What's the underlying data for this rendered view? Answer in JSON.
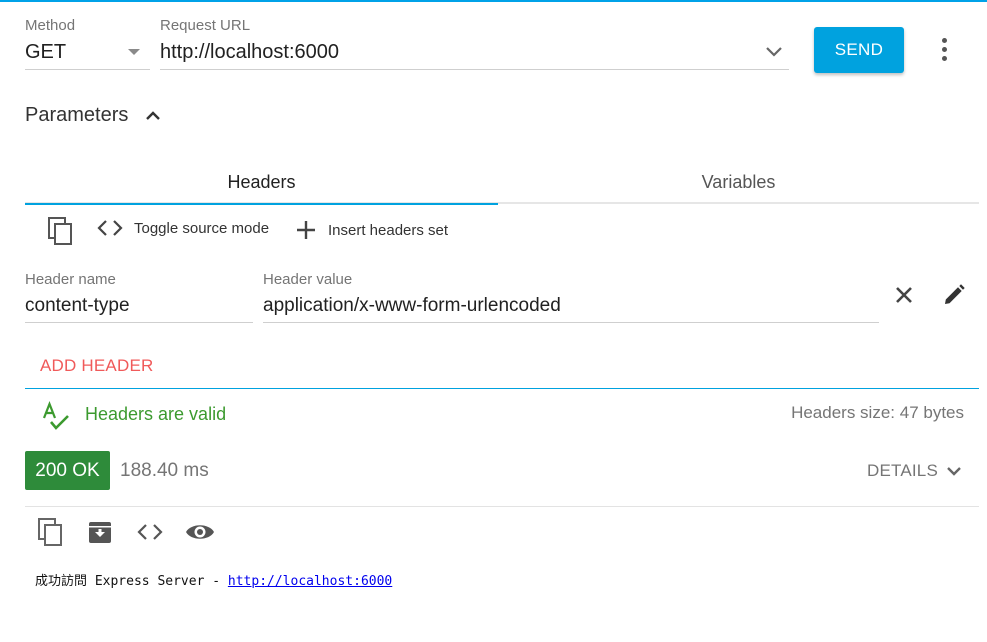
{
  "request": {
    "method_label": "Method",
    "method_value": "GET",
    "url_label": "Request URL",
    "url_value": "http://localhost:6000",
    "send_label": "SEND"
  },
  "parameters": {
    "title": "Parameters",
    "tabs": [
      {
        "label": "Headers",
        "active": true
      },
      {
        "label": "Variables",
        "active": false
      }
    ],
    "toolbar": {
      "toggle_source_label": "Toggle source mode",
      "insert_headers_label": "Insert headers set"
    },
    "header_row": {
      "name_label": "Header name",
      "name_value": "content-type",
      "value_label": "Header value",
      "value_value": "application/x-www-form-urlencoded"
    },
    "add_header_label": "ADD HEADER",
    "validation_text": "Headers are valid",
    "headers_size_text": "Headers size: 47 bytes"
  },
  "response": {
    "status_text": "200 OK",
    "time_text": "188.40 ms",
    "details_label": "DETAILS",
    "body_text": "成功訪問 Express Server - ",
    "body_link": "http://localhost:6000"
  },
  "colors": {
    "accent": "#00a2df",
    "status_ok": "#2e8b3a",
    "add_header": "#f05a5a",
    "valid": "#3c9a2f"
  },
  "icons": {
    "method_dropdown": "caret-down-icon",
    "url_dropdown": "chevron-down-icon",
    "more": "more-vert-icon",
    "params_collapse": "chevron-up-icon",
    "copy": "copy-icon",
    "code": "code-icon",
    "add": "plus-icon",
    "remove": "close-icon",
    "edit": "pencil-icon",
    "spellcheck": "spellcheck-icon",
    "archive": "archive-icon",
    "preview": "eye-icon"
  }
}
